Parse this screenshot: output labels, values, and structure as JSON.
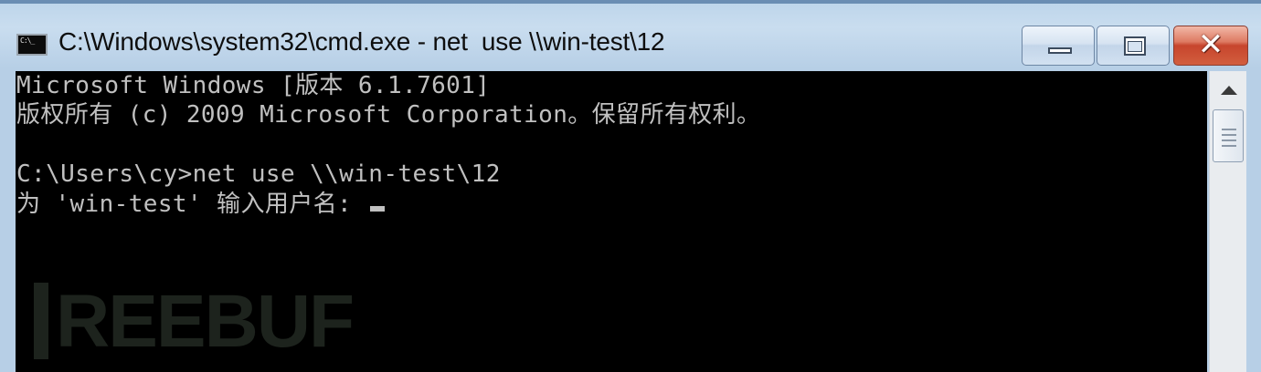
{
  "window": {
    "title": "C:\\Windows\\system32\\cmd.exe - net  use \\\\win-test\\12",
    "icon": "cmd-icon",
    "controls": {
      "minimize": "minimize-icon",
      "maximize": "maximize-icon",
      "close": "close-icon"
    }
  },
  "console": {
    "lines": [
      "Microsoft Windows [版本 6.1.7601]",
      "版权所有 (c) 2009 Microsoft Corporation。保留所有权利。",
      "",
      "C:\\Users\\cy>net use \\\\win-test\\12",
      "为 'win-test' 输入用户名: "
    ],
    "watermark": "REEBUF"
  },
  "scrollbar": {
    "up_arrow": "scroll-up-arrow-icon"
  },
  "colors": {
    "console_bg": "#000000",
    "console_fg": "#c0c0c0",
    "close_button": "#c7452d",
    "frame": "#bcd4ea"
  }
}
